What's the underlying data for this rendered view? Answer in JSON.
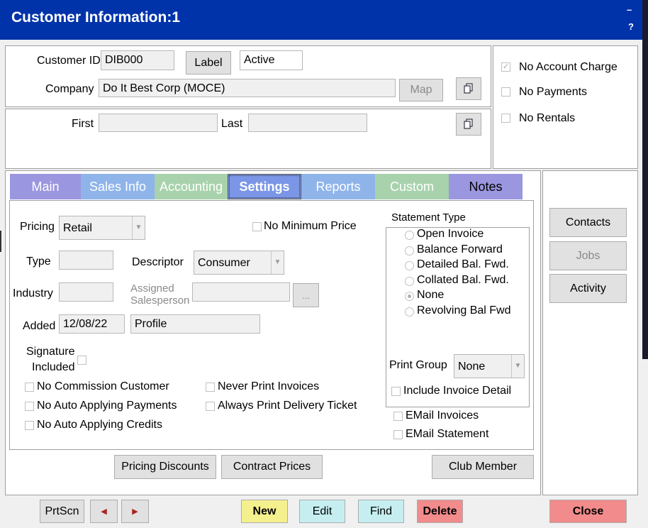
{
  "window": {
    "title": "Customer Information:1",
    "minimize_glyph": "–",
    "help_glyph": "?"
  },
  "header": {
    "customer_id_label": "Customer ID",
    "customer_id": "DIB000",
    "label_button": "Label",
    "status": "Active",
    "company_label": "Company",
    "company": "Do It Best Corp (MOCE)",
    "map_button": "Map",
    "first_label": "First",
    "first_value": "",
    "last_label": "Last",
    "last_value": ""
  },
  "flags": {
    "no_account_charge": "No Account Charge",
    "no_payments": "No Payments",
    "no_rentals": "No Rentals"
  },
  "tabs": [
    {
      "label": "Main",
      "color": "#9b96e0"
    },
    {
      "label": "Sales Info",
      "color": "#8fb4ea"
    },
    {
      "label": "Accounting",
      "color": "#a8d2ac"
    },
    {
      "label": "Settings",
      "color": "#7b96e6"
    },
    {
      "label": "Reports",
      "color": "#8fb4ea"
    },
    {
      "label": "Custom",
      "color": "#a8d2ac"
    },
    {
      "label": "Notes",
      "color": "#9b96e0"
    }
  ],
  "settings": {
    "pricing_label": "Pricing",
    "pricing_value": "Retail",
    "no_minimum_price": "No Minimum Price",
    "type_label": "Type",
    "type_value": "",
    "descriptor_label": "Descriptor",
    "descriptor_value": "Consumer",
    "industry_label": "Industry",
    "industry_value": "",
    "assigned_label_1": "Assigned",
    "assigned_label_2": "Salesperson",
    "assigned_value": "",
    "ellipsis_button": "...",
    "added_label": "Added",
    "added_value": "12/08/22",
    "profile_value": "Profile",
    "signature_label_1": "Signature",
    "signature_label_2": "Included",
    "no_commission": "No Commission Customer",
    "no_auto_payments": "No Auto Applying Payments",
    "no_auto_credits": "No Auto Applying Credits",
    "never_print_invoices": "Never Print Invoices",
    "always_print_delivery": "Always Print Delivery Ticket"
  },
  "statement": {
    "title": "Statement Type",
    "options": [
      "Open Invoice",
      "Balance Forward",
      "Detailed Bal. Fwd.",
      "Collated Bal. Fwd.",
      "None",
      "Revolving Bal Fwd"
    ],
    "selected": "None",
    "print_group_label": "Print Group",
    "print_group_value": "None",
    "include_invoice_detail": "Include Invoice Detail",
    "email_invoices": "EMail Invoices",
    "email_statement": "EMail Statement"
  },
  "buttons": {
    "pricing_discounts": "Pricing Discounts",
    "contract_prices": "Contract Prices",
    "club_member": "Club Member",
    "contacts": "Contacts",
    "jobs": "Jobs",
    "activity": "Activity"
  },
  "toolbar": {
    "prtscn": "PrtScn",
    "prev_glyph": "◀",
    "next_glyph": "▶",
    "new": "New",
    "edit": "Edit",
    "find": "Find",
    "delete": "Delete",
    "close": "Close",
    "colors": {
      "new": "#f5f08e",
      "edit": "#c6eef0",
      "find": "#c6eef0",
      "delete": "#f28b8b",
      "close": "#f28b8b"
    }
  }
}
